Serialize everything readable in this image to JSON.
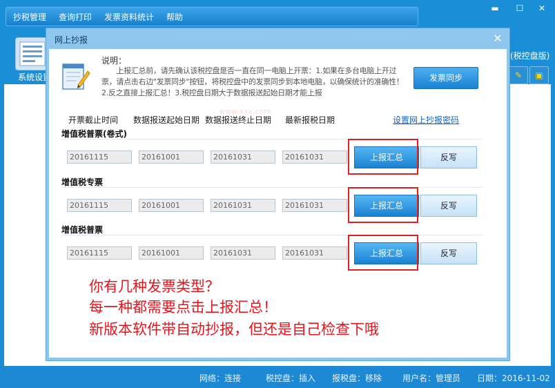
{
  "menu": [
    "抄税管理",
    "查询打印",
    "发票资料统计",
    "帮助"
  ],
  "window_controls": [
    "minimize",
    "maximize",
    "close"
  ],
  "left_tool_label": "系统设置",
  "right_label": "(税控盘版)",
  "statusbar": {
    "network": "网络：连接",
    "taxdisk": "税控盘：插入",
    "reportdisk": "报税盘：移除",
    "user": "用户名：管理员",
    "date": "日期：2016-11-02"
  },
  "dialog": {
    "title": "网上抄报",
    "desc_head": "说明：",
    "desc_text": "上报汇总前，请先确认该税控盘是否一直在同一电脑上开票：1.如果在多台电脑上开过票，请点击右边\"发票同步\"按钮，将税控盘中的发票同步到本地电脑，以确保统计的准确性！2.反之直接上报汇总！3.税控盘日期大于数据报送起始日期才能上报",
    "sync_button": "发票同步",
    "watermark": "www.xxx.com",
    "col_headers": [
      "开票截止时间",
      "数据报送起始日期",
      "数据报送终止日期",
      "最新报税日期"
    ],
    "set_password_link": "设置网上抄报密码",
    "sections": [
      {
        "title": "增值税普票(卷式)",
        "fields": [
          "20161115",
          "20161001",
          "20161031",
          "20161031"
        ],
        "upload": "上报汇总",
        "writeback": "反写"
      },
      {
        "title": "增值税专票",
        "fields": [
          "20161115",
          "20161001",
          "20161031",
          "20161031"
        ],
        "upload": "上报汇总",
        "writeback": "反写"
      },
      {
        "title": "增值税普票",
        "fields": [
          "20161115",
          "20161001",
          "20161031",
          "20161031"
        ],
        "upload": "上报汇总",
        "writeback": "反写"
      }
    ]
  },
  "annotation": [
    "你有几种发票类型？",
    "每一种都需要点击上报汇总！",
    "新版本软件带自动抄报，但还是自己检查下哦"
  ],
  "colors": {
    "accent": "#1a8fd8",
    "annotation": "#e8141c",
    "highlight_box": "#e02020"
  }
}
